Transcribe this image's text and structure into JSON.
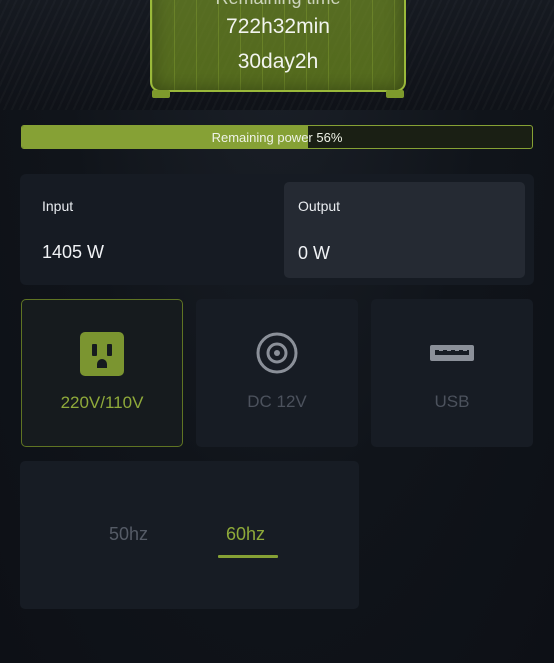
{
  "battery": {
    "remaining_time_label": "Remaining time",
    "hours_minutes": "722h32min",
    "days_hours": "30day2h"
  },
  "power": {
    "label": "Remaining power 56%",
    "percent": 56,
    "accent_color": "#86a135"
  },
  "io": {
    "input_title": "Input",
    "input_value": "1405 W",
    "output_title": "Output",
    "output_value": "0 W"
  },
  "ports": [
    {
      "label": "220V/110V",
      "icon": "ac-outlet-icon",
      "active": true
    },
    {
      "label": "DC 12V",
      "icon": "dc-port-icon",
      "active": false
    },
    {
      "label": "USB",
      "icon": "usb-icon",
      "active": false
    }
  ],
  "frequency": {
    "options": [
      "50hz",
      "60hz"
    ],
    "selected": "60hz"
  }
}
